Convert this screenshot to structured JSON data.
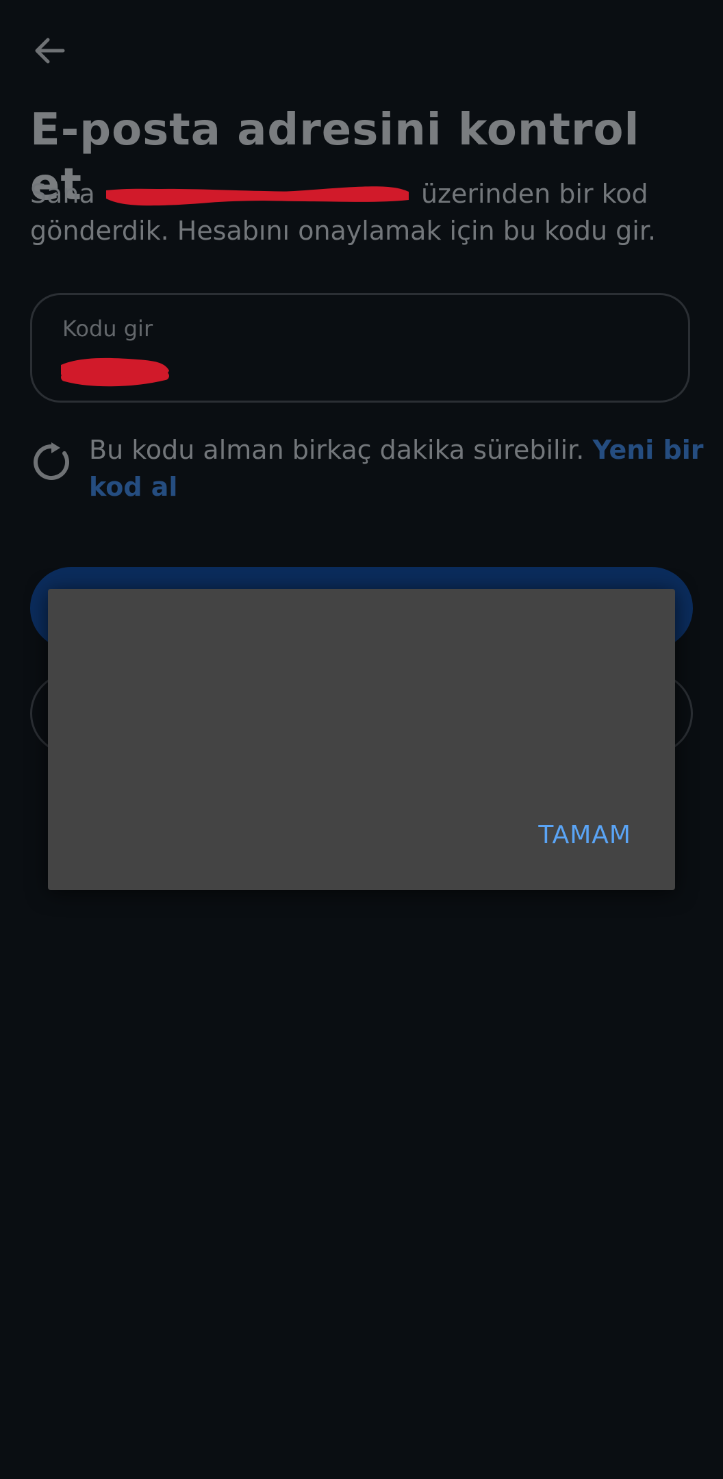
{
  "header": {
    "back_icon": "arrow-left-icon",
    "title": "E-posta adresini kontrol et"
  },
  "description": {
    "before_email": "Sana ",
    "email_redacted": "",
    "after_email": " üzerinden bir kod gönderdik. Hesabını onaylamak için bu kodu gir."
  },
  "code_input": {
    "label": "Kodu gir",
    "value_redacted": ""
  },
  "info": {
    "icon": "refresh-icon",
    "text": "Bu kodu alman birkaç dakika sürebilir. ",
    "link": "Yeni bir kod al"
  },
  "dialog": {
    "ok_label": "TAMAM"
  },
  "colors": {
    "background": "#0a0e12",
    "primary_button": "#0b2c5c",
    "link": "#254d80",
    "dialog_bg": "#444444",
    "dialog_action": "#5aa4f5",
    "redaction": "#d11a2a"
  }
}
